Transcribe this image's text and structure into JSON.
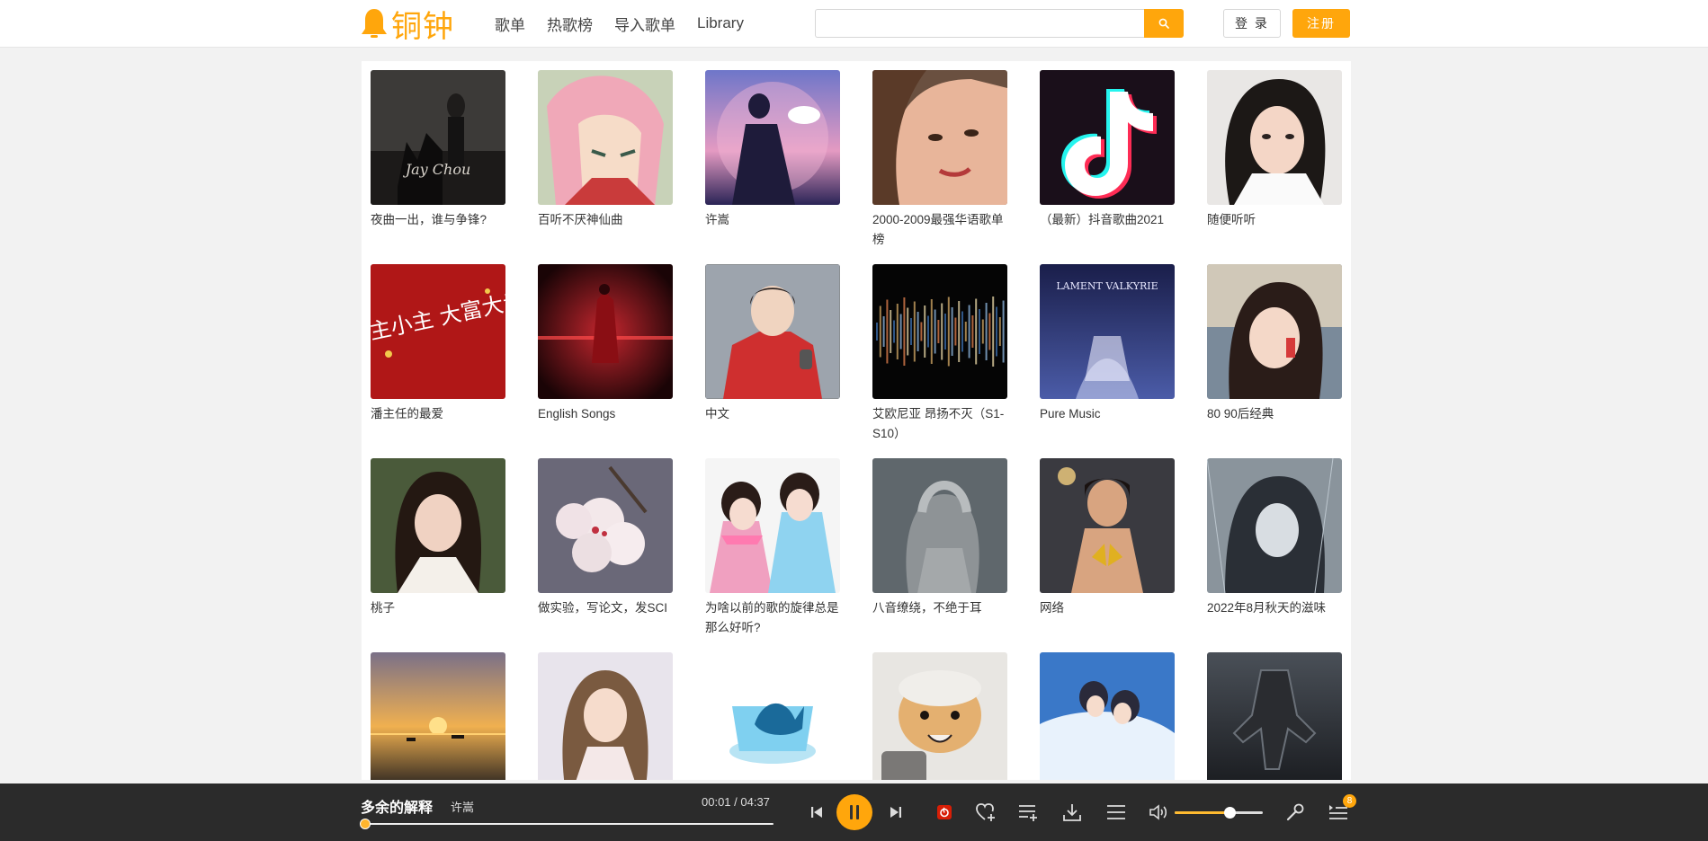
{
  "header": {
    "logo_text": "铜钟",
    "nav": [
      "歌单",
      "热歌榜",
      "导入歌单",
      "Library"
    ],
    "search": {
      "value": "",
      "placeholder": ""
    },
    "login_label": "登 录",
    "register_label": "注册"
  },
  "playlists": [
    {
      "title": "夜曲一出，谁与争锋?",
      "cover_text": "Jay Chou"
    },
    {
      "title": "百听不厌神仙曲"
    },
    {
      "title": "许嵩"
    },
    {
      "title": "2000-2009最强华语歌单榜"
    },
    {
      "title": "（最新）抖音歌曲2021"
    },
    {
      "title": "随便听听"
    },
    {
      "title": "潘主任的最爱",
      "cover_text": "小主小主 大富大贵"
    },
    {
      "title": "English Songs"
    },
    {
      "title": "中文"
    },
    {
      "title": "艾欧尼亚 昂扬不灭（S1-S10）"
    },
    {
      "title": "Pure Music",
      "cover_text": "LAMENT VALKYRIE"
    },
    {
      "title": "80 90后经典"
    },
    {
      "title": "桃子"
    },
    {
      "title": "做实验，写论文，发SCI"
    },
    {
      "title": "为啥以前的歌的旋律总是那么好听?"
    },
    {
      "title": "八音缭绕，不绝于耳"
    },
    {
      "title": "网络"
    },
    {
      "title": "2022年8月秋天的滋味"
    },
    {
      "title": ""
    },
    {
      "title": ""
    },
    {
      "title": ""
    },
    {
      "title": ""
    },
    {
      "title": ""
    },
    {
      "title": ""
    }
  ],
  "player": {
    "song_title": "多余的解释",
    "artist": "许嵩",
    "time": "00:01 / 04:37",
    "progress": 0.004,
    "volume": 0.62,
    "queue_count": "8"
  },
  "colors": {
    "accent": "#ffa60c",
    "player_bg": "#2b2b2b"
  },
  "icons": [
    "bell-logo-icon",
    "search-icon",
    "prev-icon",
    "pause-icon",
    "next-icon",
    "netease-icon",
    "like-icon",
    "add-to-list-icon",
    "download-icon",
    "playlist-icon",
    "volume-icon",
    "settings-icon",
    "queue-icon"
  ]
}
